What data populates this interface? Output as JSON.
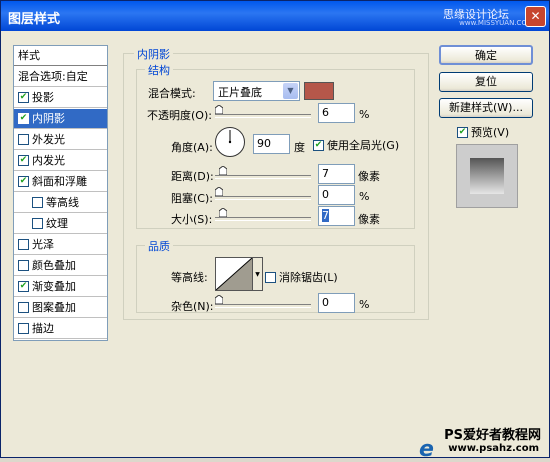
{
  "title": "图层样式",
  "watermark": "思缘设计论坛",
  "watermark_url": "www.MISSYUAN.COM",
  "close_glyph": "✕",
  "styles_header": "样式",
  "style_items": [
    {
      "label": "混合选项:自定",
      "checkbox": false
    },
    {
      "label": "投影",
      "checkbox": true,
      "checked": true
    },
    {
      "label": "内阴影",
      "checkbox": true,
      "checked": true,
      "selected": true
    },
    {
      "label": "外发光",
      "checkbox": true,
      "checked": false
    },
    {
      "label": "内发光",
      "checkbox": true,
      "checked": true
    },
    {
      "label": "斜面和浮雕",
      "checkbox": true,
      "checked": true
    },
    {
      "label": "等高线",
      "checkbox": true,
      "checked": false,
      "sub": true
    },
    {
      "label": "纹理",
      "checkbox": true,
      "checked": false,
      "sub": true
    },
    {
      "label": "光泽",
      "checkbox": true,
      "checked": false
    },
    {
      "label": "颜色叠加",
      "checkbox": true,
      "checked": false
    },
    {
      "label": "渐变叠加",
      "checkbox": true,
      "checked": true
    },
    {
      "label": "图案叠加",
      "checkbox": true,
      "checked": false
    },
    {
      "label": "描边",
      "checkbox": true,
      "checked": false
    }
  ],
  "section_title": "内阴影",
  "structure": {
    "legend": "结构",
    "blend_mode_label": "混合模式:",
    "blend_mode_value": "正片叠底",
    "blend_color": "#b5574a",
    "opacity_label": "不透明度(O):",
    "opacity_value": "6",
    "opacity_unit": "%",
    "angle_label": "角度(A):",
    "angle_value": "90",
    "angle_unit": "度",
    "global_light_label": "使用全局光(G)",
    "global_light_checked": true,
    "distance_label": "距离(D):",
    "distance_value": "7",
    "distance_unit": "像素",
    "choke_label": "阻塞(C):",
    "choke_value": "0",
    "choke_unit": "%",
    "size_label": "大小(S):",
    "size_value": "7",
    "size_unit": "像素"
  },
  "quality": {
    "legend": "品质",
    "contour_label": "等高线:",
    "antialias_label": "消除锯齿(L)",
    "antialias_checked": false,
    "noise_label": "杂色(N):",
    "noise_value": "0",
    "noise_unit": "%"
  },
  "buttons": {
    "ok": "确定",
    "reset": "复位",
    "new_style": "新建样式(W)...",
    "preview_label": "预览(V)",
    "preview_checked": true
  },
  "logo": {
    "line1": "PS爱好者教程网",
    "line2": "www.psahz.com",
    "mark": "e"
  }
}
